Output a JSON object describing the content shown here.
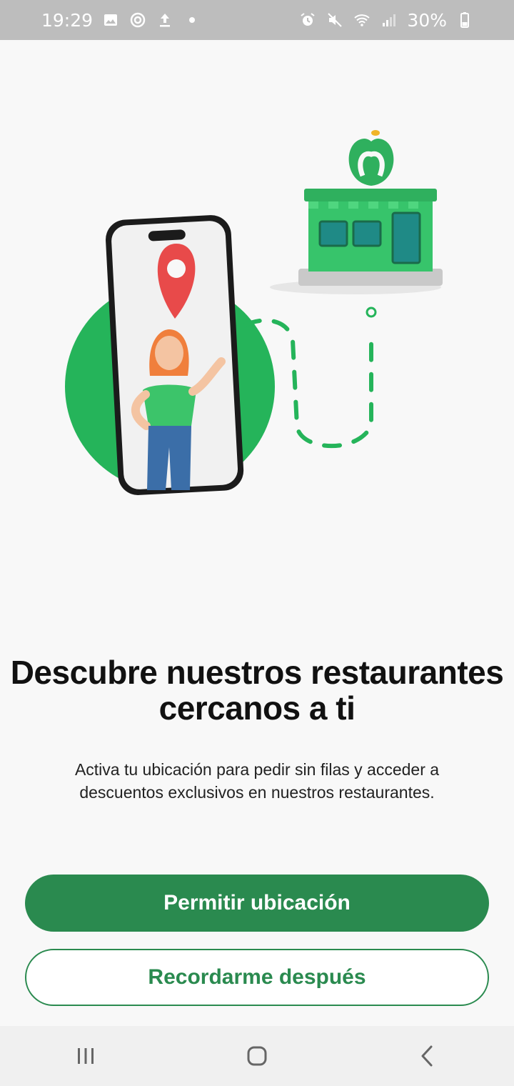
{
  "status_bar": {
    "time": "19:29",
    "battery": "30%",
    "left_icons": [
      "image-icon",
      "sync-icon",
      "upload-icon",
      "dot-icon"
    ],
    "right_icons": [
      "alarm-icon",
      "mute-icon",
      "wifi-icon",
      "signal-icon",
      "battery-icon"
    ]
  },
  "illustration": {
    "description_icons": [
      "phone-icon",
      "location-pin-icon",
      "person-pointing-icon",
      "store-icon",
      "apple-logo-icon",
      "dashed-route-icon"
    ],
    "colors": {
      "green": "#25b45a",
      "pin_red": "#e84a4a",
      "store_green": "#35c46a"
    }
  },
  "main": {
    "title": "Descubre nuestros restaurantes cercanos a ti",
    "subtitle": "Activa tu ubicación para pedir sin filas y acceder a descuentos exclusivos en nuestros restaurantes.",
    "allow_button": "Permitir ubicación",
    "later_button": "Recordarme después"
  },
  "colors": {
    "accent": "#2a8a4f",
    "background": "#f8f8f8"
  },
  "nav_bar": {
    "icons": [
      "recent-apps-icon",
      "home-icon",
      "back-icon"
    ]
  }
}
